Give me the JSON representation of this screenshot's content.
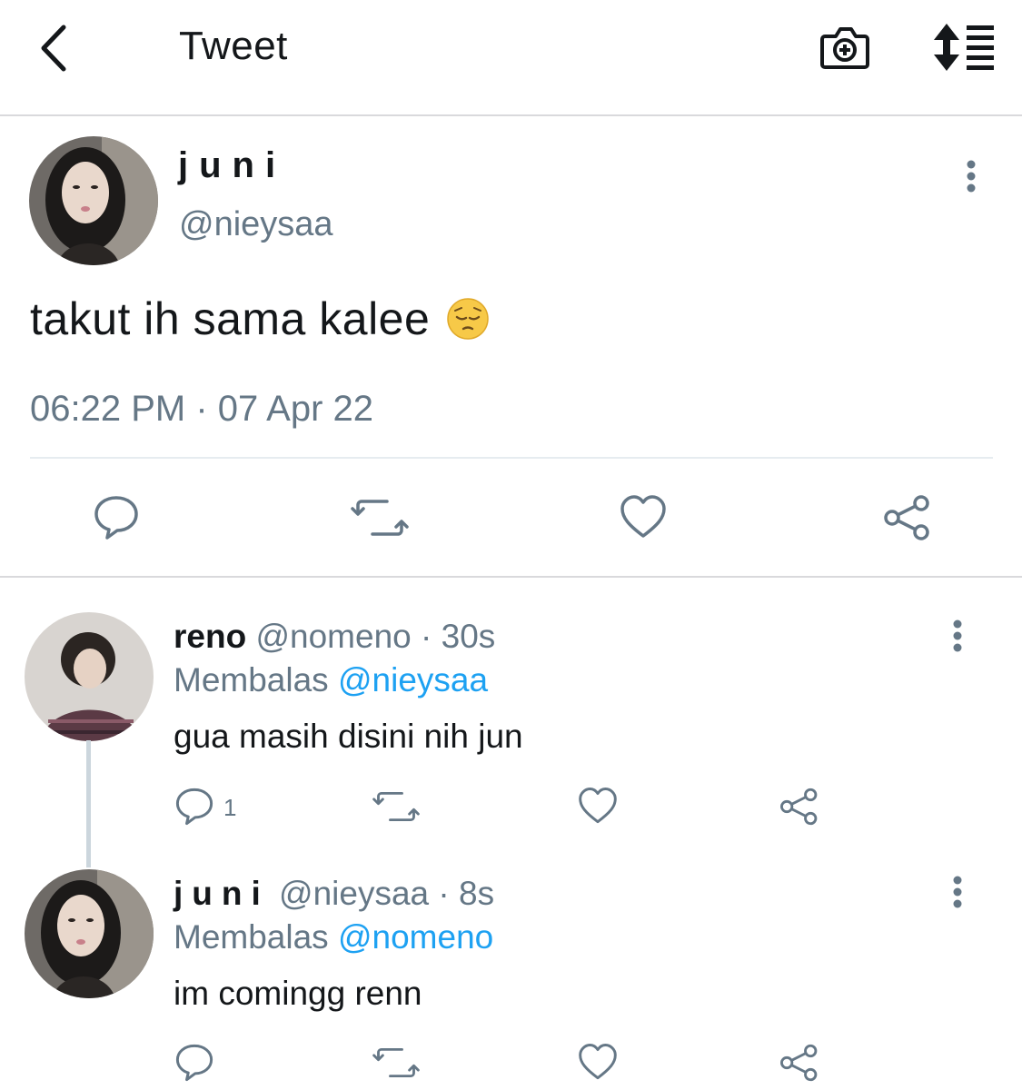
{
  "header": {
    "title": "Tweet",
    "back_icon": "chevron-left-icon",
    "camera_icon": "camera-plus-icon",
    "sort_icon": "sort-list-icon"
  },
  "main_tweet": {
    "name": "juni",
    "handle": "@nieysaa",
    "text": "takut ih sama kalee",
    "emoji": "pensive-face",
    "timestamp": "06:22 PM · 07 Apr 22",
    "actions": [
      "reply-icon",
      "retweet-icon",
      "like-icon",
      "share-icon"
    ]
  },
  "replies": [
    {
      "name": "reno",
      "handle": "@nomeno",
      "separator": " · ",
      "time": "30s",
      "replying_label": "Membalas",
      "replying_to": "@nieysaa",
      "text": "gua masih disini nih jun",
      "reply_count": "1"
    },
    {
      "name": "juni",
      "handle": "@nieysaa",
      "separator": " · ",
      "time": "8s",
      "replying_label": "Membalas",
      "replying_to": "@nomeno",
      "text": "im comingg renn",
      "reply_count": ""
    }
  ],
  "colors": {
    "text": "#14171a",
    "secondary": "#657786",
    "link": "#1da1f2",
    "divider": "#e6ecf0"
  }
}
